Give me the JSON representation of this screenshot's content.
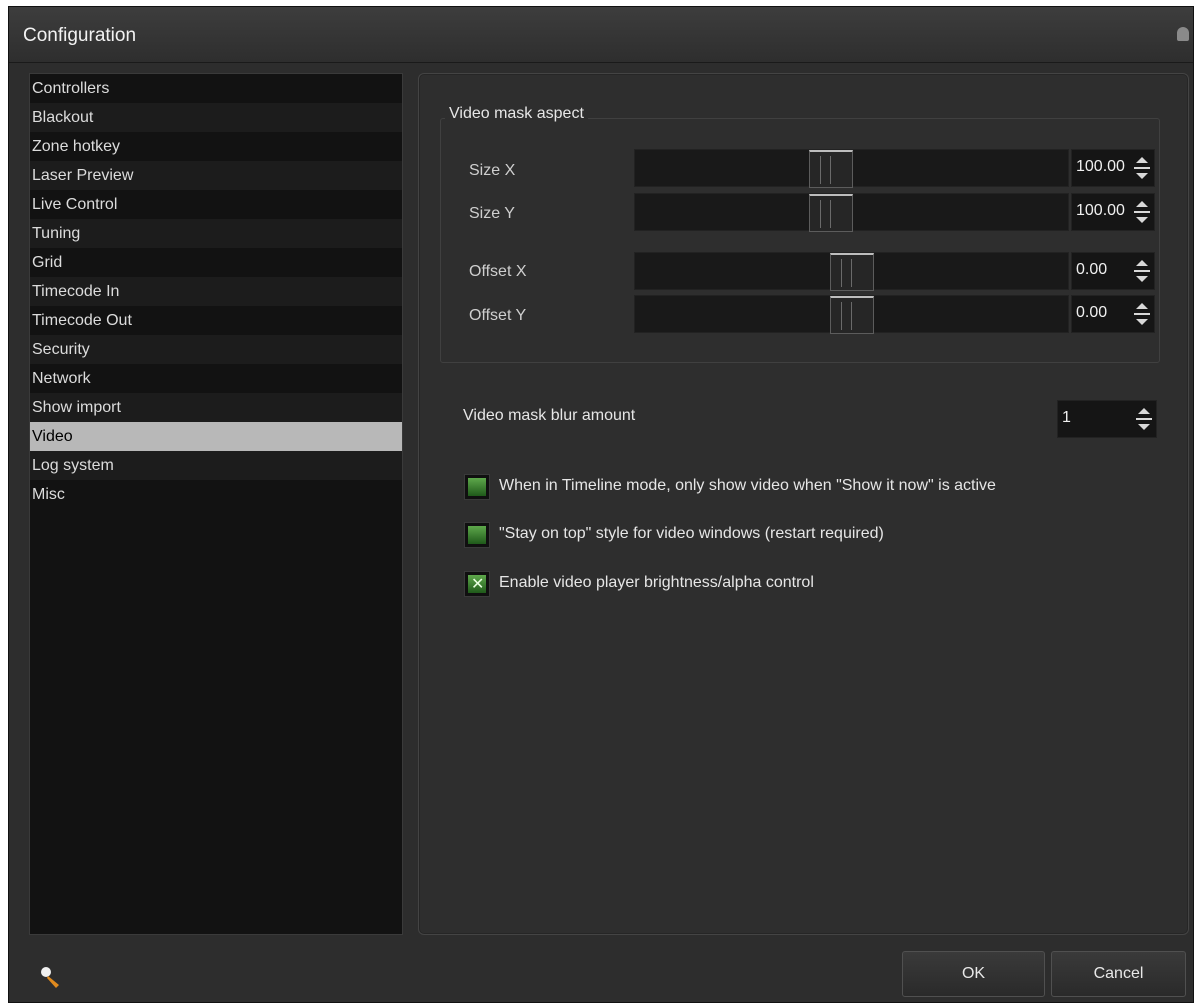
{
  "window": {
    "title": "Configuration"
  },
  "sidebar": {
    "items": [
      {
        "label": "Controllers"
      },
      {
        "label": "Blackout"
      },
      {
        "label": "Zone hotkey"
      },
      {
        "label": "Laser Preview"
      },
      {
        "label": "Live Control"
      },
      {
        "label": "Tuning"
      },
      {
        "label": "Grid"
      },
      {
        "label": "Timecode In"
      },
      {
        "label": "Timecode Out"
      },
      {
        "label": "Security"
      },
      {
        "label": "Network"
      },
      {
        "label": "Show import"
      },
      {
        "label": "Video"
      },
      {
        "label": "Log system"
      },
      {
        "label": "Misc"
      }
    ],
    "selected": "Video"
  },
  "video_mask_aspect": {
    "title": "Video mask aspect",
    "size_x": {
      "label": "Size X",
      "value": "100.00"
    },
    "size_y": {
      "label": "Size Y",
      "value": "100.00"
    },
    "offset_x": {
      "label": "Offset X",
      "value": "0.00"
    },
    "offset_y": {
      "label": "Offset Y",
      "value": "0.00"
    }
  },
  "blur": {
    "label": "Video mask blur amount",
    "value": "1"
  },
  "options": [
    {
      "label": "When in Timeline mode, only show video when \"Show it now\" is active",
      "checked": false
    },
    {
      "label": "\"Stay on top\" style for video windows (restart required)",
      "checked": false
    },
    {
      "label": "Enable video player brightness/alpha control",
      "checked": true
    }
  ],
  "buttons": {
    "ok": "OK",
    "cancel": "Cancel"
  },
  "icons": {
    "pin": "pin-icon",
    "footer": "wand-icon"
  },
  "colors": {
    "accent_green": "#4e9a3e",
    "selected_bg": "#b8b8b8"
  }
}
